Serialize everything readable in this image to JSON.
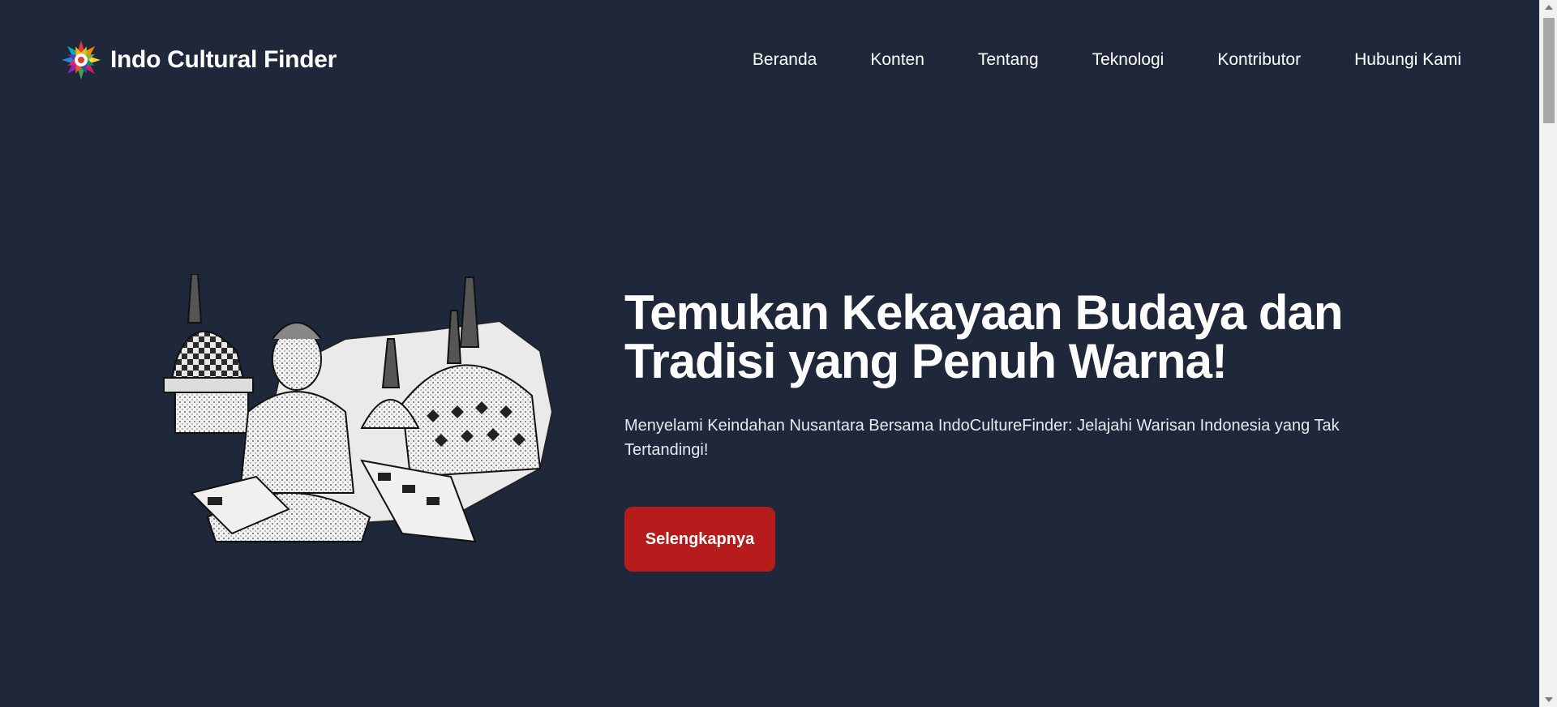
{
  "brand": {
    "name": "Indo Cultural Finder",
    "logo_icon": "flower-star-logo-icon"
  },
  "nav": {
    "items": [
      {
        "label": "Beranda"
      },
      {
        "label": "Konten"
      },
      {
        "label": "Tentang"
      },
      {
        "label": "Teknologi"
      },
      {
        "label": "Kontributor"
      },
      {
        "label": "Hubungi Kami"
      }
    ]
  },
  "hero": {
    "title_line1": "Temukan Kekayaan Budaya dan",
    "title_line2": "Tradisi yang Penuh Warna!",
    "subtitle": "Menyelami Keindahan Nusantara Bersama IndoCultureFinder: Jelajahi Warisan Indonesia yang Tak Tertandingi!",
    "cta_label": "Selengkapnya",
    "illustration": "borobudur-stupa-buddha-illustration"
  },
  "colors": {
    "background": "#1f283a",
    "cta": "#b71c1c",
    "text": "#ffffff"
  }
}
